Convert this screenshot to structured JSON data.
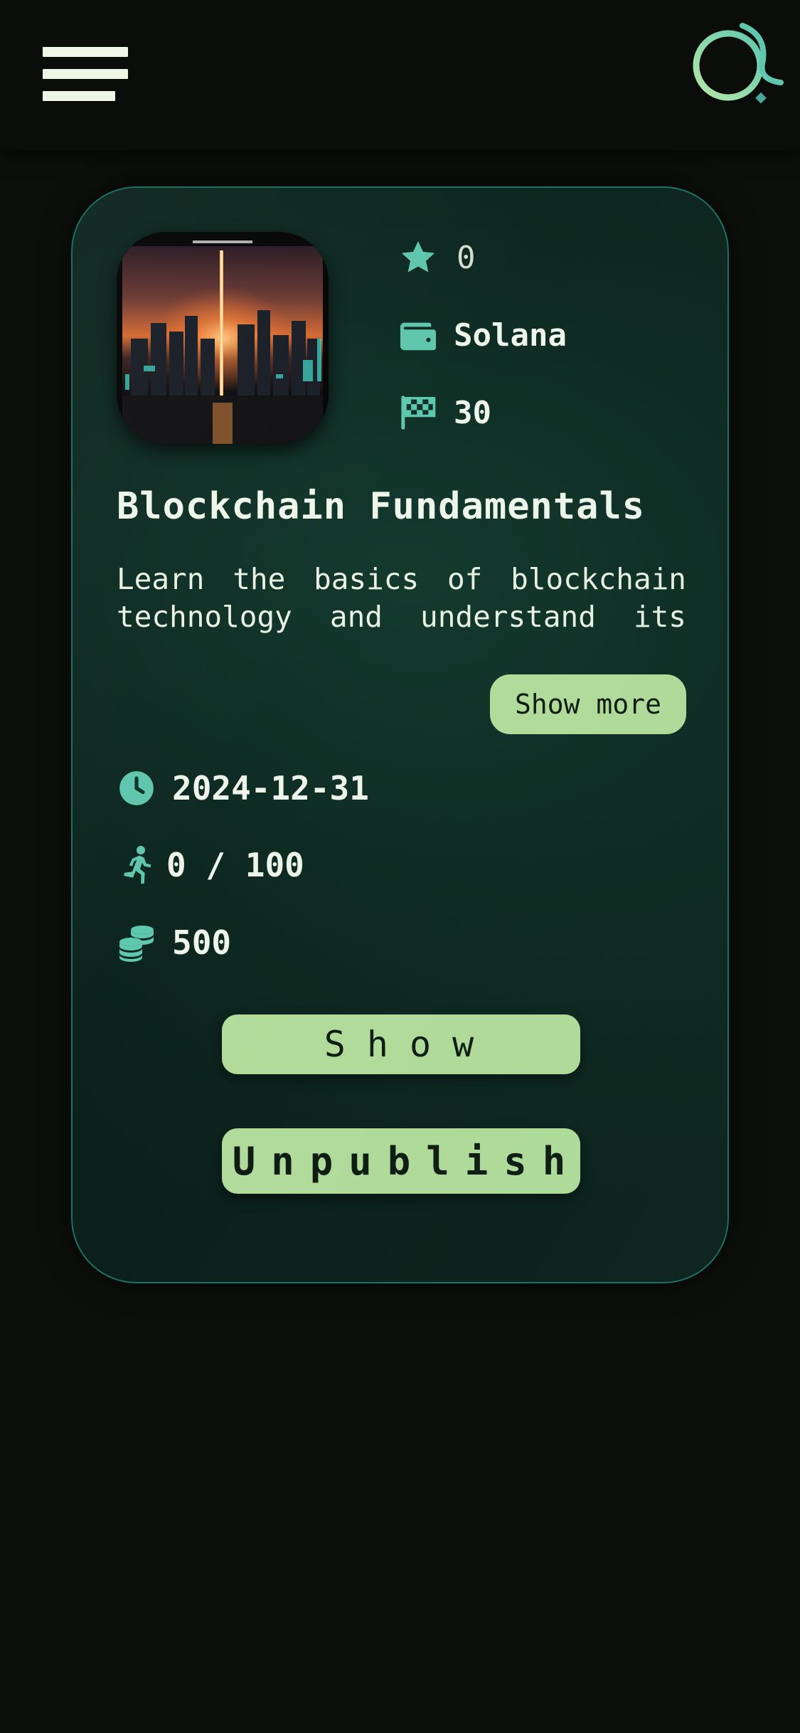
{
  "header": {
    "menu_icon": "hamburger-menu-icon",
    "logo_icon": "app-logo-rings-icon",
    "accent_color": "#5fc7ad",
    "logo_color": "#9be0a6"
  },
  "card": {
    "image": "city-skyline-sunset-thumbnail",
    "meta": {
      "rating": "0",
      "rating_icon": "star-icon",
      "chain": "Solana",
      "chain_icon": "wallet-icon",
      "tasks": "30",
      "tasks_icon": "checkered-flag-icon"
    },
    "title": "Blockchain Fundamentals",
    "description": "Learn the basics of blockchain technology and understand its",
    "show_more_label": "Show more",
    "deadline": "2024-12-31",
    "deadline_icon": "clock-icon",
    "participants": "0 / 100",
    "participants_icon": "running-person-icon",
    "reward": "500",
    "reward_icon": "coins-icon",
    "show_label": "Show",
    "unpublish_label": "Unpublish",
    "button_color": "#b3dc9b",
    "border_color": "#1f6f64"
  }
}
